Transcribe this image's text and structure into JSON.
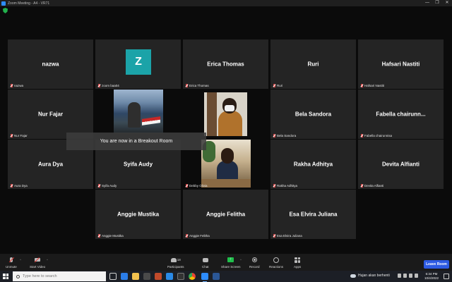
{
  "window": {
    "title": "Zoom Meeting - A4 - VR71",
    "controls": [
      "—",
      "❐",
      "✕"
    ]
  },
  "tiles": {
    "nazwa": {
      "name": "nazwa",
      "label": "nazwa"
    },
    "zoom": {
      "initial": "Z",
      "label": "zoom baa04"
    },
    "erica": {
      "name": "Erica Thomas",
      "label": "Erica Thomas"
    },
    "ruri": {
      "name": "Ruri",
      "label": "Ruri"
    },
    "hafsari": {
      "name": "Hafsari Nastiti",
      "label": "Hafsari Nastiti"
    },
    "nur": {
      "name": "Nur Fajar",
      "label": "Nur Fajar"
    },
    "bela": {
      "name": "Bela Sandora",
      "label": "Bela Sandora"
    },
    "fabella": {
      "name": "Fabella  chairunn...",
      "label": "Fabella chairunnisa"
    },
    "aura": {
      "name": "Aura Dya",
      "label": "Aura Dya"
    },
    "syifa": {
      "name": "Syifa Audy",
      "label": "Syifa Audy"
    },
    "debby": {
      "label": "Debby Olivia"
    },
    "rakha": {
      "name": "Rakha Adhitya",
      "label": "Rakha Adhitya"
    },
    "devita": {
      "name": "Devita Alfianti",
      "label": "Devita Alfianti"
    },
    "anggie_m": {
      "name": "Anggie Mustika",
      "label": "Anggie Mustika"
    },
    "anggie_f": {
      "name": "Anggie Felitha",
      "label": "Anggie Felitha"
    },
    "esa": {
      "name": "Esa Elvira Juliana",
      "label": "Esa Elvira Juliana"
    }
  },
  "breakout_message": "You are now in a Breakout Room",
  "toolbar": {
    "unmute": "Unmute",
    "start_video": "Start Video",
    "participants": "Participants",
    "participants_count": "18",
    "chat": "Chat",
    "share_screen": "Share Screen",
    "record": "Record",
    "reactions": "Reactions",
    "apps": "Apps",
    "leave": "Leave Room"
  },
  "taskbar": {
    "search_placeholder": "Type here to search",
    "weather": "Hujan akan berhenti",
    "time": "6:34 PM",
    "date": "10/4/2022"
  },
  "colors": {
    "accent": "#2d8cff",
    "leave": "#2d5be3",
    "share": "#1fbf4b",
    "muted": "#e24b4b",
    "avatar_z": "#1ba3a8"
  }
}
